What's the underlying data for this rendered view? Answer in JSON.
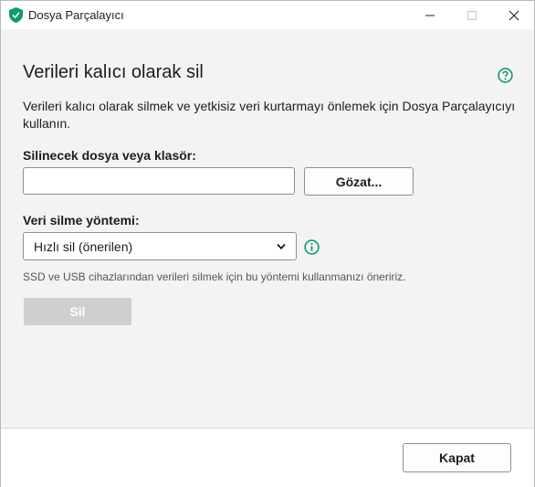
{
  "window": {
    "title": "Dosya Parçalayıcı"
  },
  "main": {
    "heading": "Verileri kalıcı olarak sil",
    "description": "Verileri kalıcı olarak silmek ve yetkisiz veri kurtarmayı önlemek için Dosya Parçalayıcıyı kullanın.",
    "file_label": "Silinecek dosya veya klasör:",
    "file_input_value": "",
    "browse_label": "Gözat...",
    "method_label": "Veri silme yöntemi:",
    "method_selected": "Hızlı sil (önerilen)",
    "note": "SSD ve USB cihazlarından verileri silmek için bu yöntemi kullanmanızı öneririz.",
    "delete_label": "Sil"
  },
  "footer": {
    "close_label": "Kapat"
  },
  "icons": {
    "app": "shield-icon",
    "help": "help-icon",
    "info": "info-icon",
    "dropdown": "chevron-down-icon"
  },
  "colors": {
    "accent": "#0f9a6b",
    "disabled_button": "#cfcfcf",
    "background": "#f3f3f3"
  }
}
